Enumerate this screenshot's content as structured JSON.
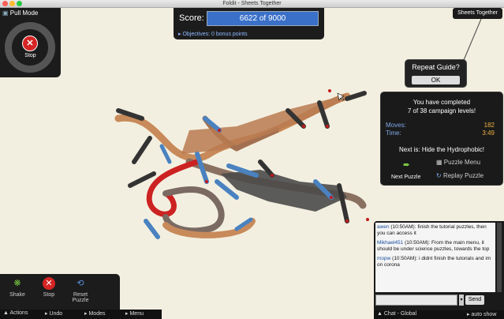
{
  "window": {
    "title": "Foldit - Sheets Together"
  },
  "pull_panel": {
    "title": "Pull Mode",
    "stop_label": "Stop"
  },
  "score": {
    "label": "Score:",
    "value": "6622 of 9000",
    "objectives": "Objectives: 0 bonus points",
    "progress": 0.7358
  },
  "sheets_tab": {
    "label": "Sheets Together"
  },
  "repeat_guide": {
    "title": "Repeat Guide?",
    "ok": "OK"
  },
  "completion": {
    "line1": "You have completed",
    "line2": "7 of 38 campaign levels!",
    "moves_label": "Moves:",
    "moves_value": "182",
    "time_label": "Time:",
    "time_value": "3:49",
    "next_is": "Next is: Hide the Hydrophobic!",
    "next_puzzle": "Next Puzzle",
    "puzzle_menu": "Puzzle Menu",
    "replay_puzzle": "Replay Puzzle"
  },
  "tools": {
    "shake": "Shake",
    "stop": "Stop",
    "reset": "Reset Puzzle"
  },
  "bottom_bar": {
    "actions": "Actions",
    "undo": "Undo",
    "modes": "Modes",
    "menu": "Menu"
  },
  "chat": {
    "messages": [
      {
        "name": "awen",
        "time": "(10:50AM):",
        "text": "finish the tutorial puzzles, then you can access it"
      },
      {
        "name": "Mikhael451",
        "time": "(10:50AM):",
        "text": "From the main menu, it should be under science puzzles, towards the top"
      },
      {
        "name": "mopw",
        "time": "(10:50AM):",
        "text": "i didnt finish the tutorials and im on corona"
      }
    ],
    "send": "Send",
    "channel": "Chat - Global",
    "auto_show": "auto show"
  },
  "colors": {
    "brand_stop": "#d62424",
    "score_bar": "#3a70c8",
    "moves_value": "#f0b040"
  }
}
